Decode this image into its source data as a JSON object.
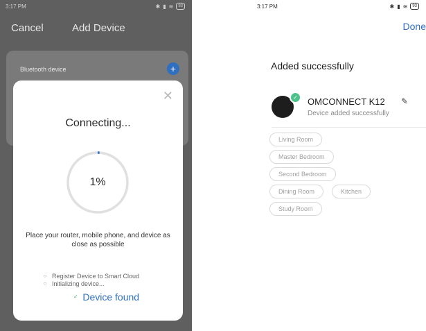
{
  "left_screen": {
    "status_time": "3:17 PM",
    "status_icons": [
      "bluetooth-icon",
      "signal-icon",
      "wifi-icon",
      "battery-icon"
    ],
    "battery_level": "93",
    "cancel_label": "Cancel",
    "title": "Add Device",
    "bluetooth_label": "Bluetooth device",
    "dialog": {
      "title": "Connecting...",
      "progress_text": "1%",
      "progress_fraction": 0.01,
      "tip": "Place your router, mobile phone, and device as close as possible",
      "steps": [
        {
          "label": "Device found",
          "state": "done"
        },
        {
          "label": "Register Device to Smart Cloud",
          "state": "pending"
        },
        {
          "label": "Initializing device...",
          "state": "pending"
        }
      ]
    }
  },
  "right_screen": {
    "status_time": "3:17 PM",
    "battery_level": "93",
    "done_label": "Done",
    "heading": "Added successfully",
    "device": {
      "name": "OMCONNECT K12",
      "status": "Device added successfully"
    },
    "rooms": [
      [
        "Living Room"
      ],
      [
        "Master Bedroom"
      ],
      [
        "Second Bedroom"
      ],
      [
        "Dining Room",
        "Kitchen"
      ],
      [
        "Study Room"
      ]
    ]
  },
  "colors": {
    "accent": "#2f6fc2",
    "success": "#4cc38a",
    "progress_track": "#e0e0e0"
  }
}
